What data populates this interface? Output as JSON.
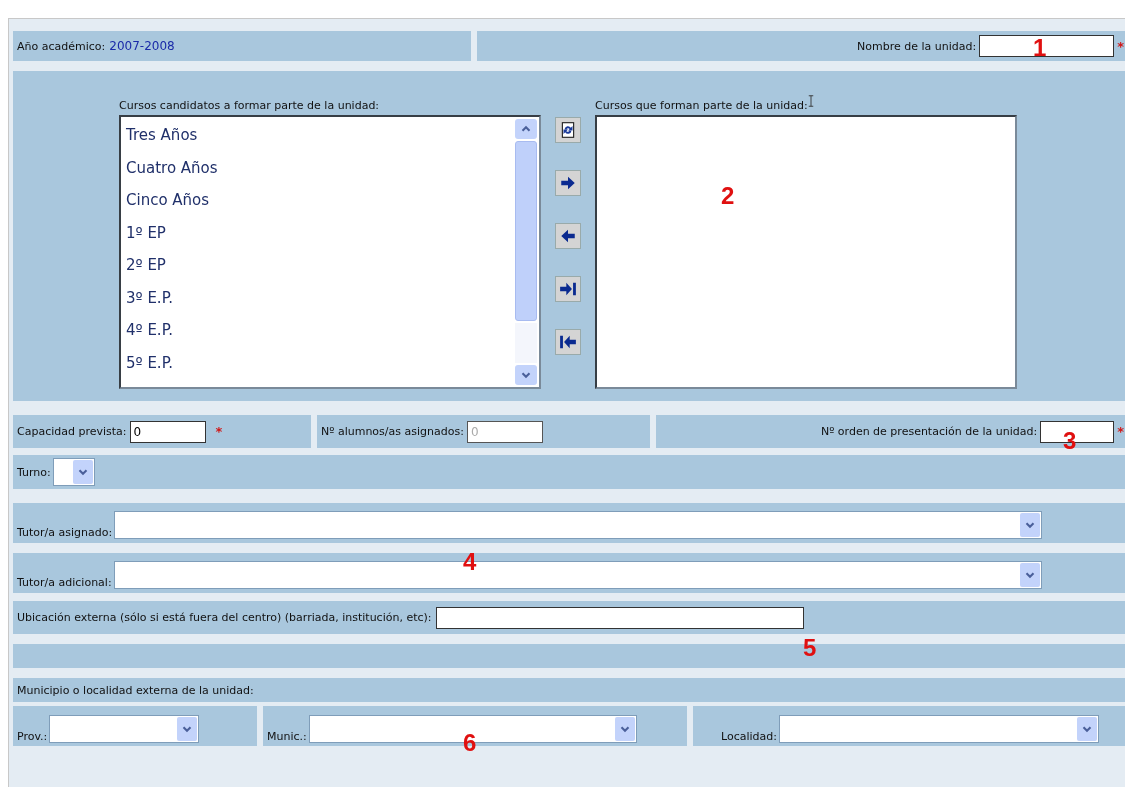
{
  "header": {
    "academic_year_label": "Año académico:",
    "academic_year": "2007-2008",
    "unit_name_label": "Nombre de la unidad:",
    "unit_name_required_mark": "*"
  },
  "courses": {
    "candidates_label": "Cursos candidatos a formar parte de la unidad:",
    "members_label": "Cursos que forman parte de la unidad:",
    "candidates": [
      {
        "label": "Tres Años",
        "selected": false
      },
      {
        "label": "Cuatro Años",
        "selected": false
      },
      {
        "label": "Cinco Años",
        "selected": false
      },
      {
        "label": "1º EP",
        "selected": false
      },
      {
        "label": "2º EP",
        "selected": false
      },
      {
        "label": "3º E.P.",
        "selected": false
      },
      {
        "label": "4º E.P.",
        "selected": false
      },
      {
        "label": "5º E.P.",
        "selected": false
      }
    ]
  },
  "capacity": {
    "label": "Capacidad prevista:",
    "value": "0",
    "required_mark": "*"
  },
  "assigned": {
    "label": "Nº alumnos/as asignados:",
    "value": "0",
    "disabled": true
  },
  "order": {
    "label": "Nº orden de presentación de la unidad:",
    "required_mark": "*"
  },
  "shift": {
    "label": "Turno:"
  },
  "tutor_assigned": {
    "label": "Tutor/a asignado:"
  },
  "tutor_additional": {
    "label": "Tutor/a adicional:"
  },
  "external_location": {
    "label": "Ubicación externa (sólo si está fuera del centro) (barriada, institución, etc):"
  },
  "municipality": {
    "label": "Municipio o localidad externa de la unidad:",
    "province_label": "Prov.:",
    "municipality_label": "Munic.:",
    "locality_label": "Localidad:"
  },
  "annotations": [
    {
      "text": "1"
    },
    {
      "text": "2"
    },
    {
      "text": "3"
    },
    {
      "text": "4"
    },
    {
      "text": "5"
    },
    {
      "text": "6"
    }
  ]
}
